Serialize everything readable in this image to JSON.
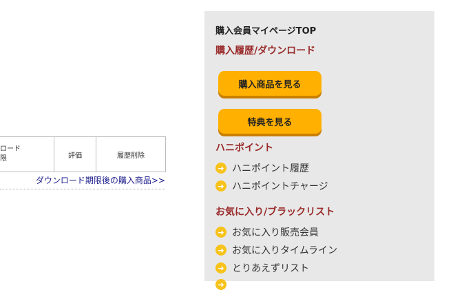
{
  "table": {
    "col_download": [
      "ンロード",
      "期限"
    ],
    "col_rating": "評価",
    "col_delete": "履歴削除"
  },
  "expired_link": "ダウンロード期限後の購入商品>>",
  "sidebar": {
    "top_link": "購入会員マイページTOP",
    "section_purchase": "購入履歴/ダウンロード",
    "btn_view_purchases": "購入商品を見る",
    "btn_view_bonus": "特典を見る",
    "section_points": "ハニポイント",
    "link_point_history": "ハニポイント履歴",
    "link_point_charge": "ハニポイントチャージ",
    "section_favorites": "お気に入り/ブラックリスト",
    "link_fav_sellers": "お気に入り販売会員",
    "link_fav_timeline": "お気に入りタイムライン",
    "link_wishlist": "とりあえずリスト",
    "arrow_icon": "arrow-right-circle-icon",
    "colors": {
      "panel_bg": "#e8e8e8",
      "section_title": "#9a2a2a",
      "button": "#ffb000",
      "button_shadow": "#c97f00",
      "arrow": "#f7c21a",
      "link_blue": "#1a1a8c"
    }
  }
}
